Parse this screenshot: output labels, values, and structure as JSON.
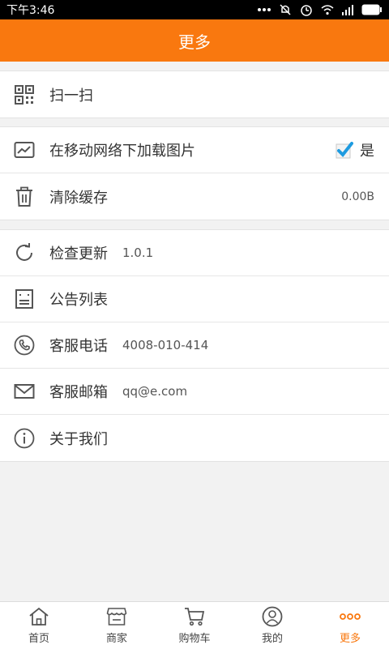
{
  "status_bar": {
    "time": "下午3:46"
  },
  "header": {
    "title": "更多"
  },
  "groups": [
    {
      "items": [
        {
          "icon": "qrcode-icon",
          "label": "扫一扫"
        }
      ]
    },
    {
      "items": [
        {
          "icon": "image-icon",
          "label": "在移动网络下加载图片",
          "right": "是",
          "checked": true
        },
        {
          "icon": "trash-icon",
          "label": "清除缓存",
          "right": "0.00B"
        }
      ]
    },
    {
      "items": [
        {
          "icon": "refresh-icon",
          "label": "检查更新",
          "sub": "1.0.1"
        },
        {
          "icon": "notice-icon",
          "label": "公告列表"
        },
        {
          "icon": "phone-icon",
          "label": "客服电话",
          "sub": "4008-010-414"
        },
        {
          "icon": "mail-icon",
          "label": "客服邮箱",
          "sub": "qq@e.com"
        },
        {
          "icon": "info-icon",
          "label": "关于我们"
        }
      ]
    }
  ],
  "tabs": [
    {
      "icon": "home-icon",
      "label": "首页"
    },
    {
      "icon": "store-icon",
      "label": "商家"
    },
    {
      "icon": "cart-icon",
      "label": "购物车"
    },
    {
      "icon": "user-icon",
      "label": "我的"
    },
    {
      "icon": "more-icon",
      "label": "更多",
      "active": true
    }
  ],
  "colors": {
    "accent": "#f9780f",
    "check": "#1e9be0"
  }
}
